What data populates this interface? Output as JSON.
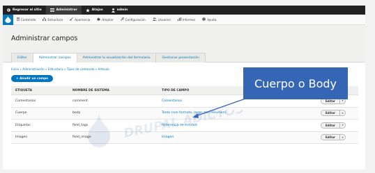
{
  "toolbar": {
    "items": [
      {
        "label": "Regresar al sitio",
        "icon": "arrow-left-icon"
      },
      {
        "label": "Administrar",
        "icon": "menu-icon"
      },
      {
        "label": "Atajos",
        "icon": "star-icon"
      },
      {
        "label": "admin",
        "icon": "user-icon"
      }
    ]
  },
  "subbar": {
    "items": [
      {
        "label": "Contenido",
        "icon": "document-icon"
      },
      {
        "label": "Estructura",
        "icon": "structure-icon"
      },
      {
        "label": "Apariencia",
        "icon": "brush-icon"
      },
      {
        "label": "Ampliar",
        "icon": "puzzle-icon"
      },
      {
        "label": "Configuración",
        "icon": "wrench-icon"
      },
      {
        "label": "Usuarios",
        "icon": "users-icon"
      },
      {
        "label": "Informes",
        "icon": "chart-icon"
      },
      {
        "label": "Ayuda",
        "icon": "help-icon"
      }
    ]
  },
  "header": {
    "title": "Administrar campos",
    "tabs": [
      "Editar",
      "Administrar campos",
      "Administrar la visualización del formulario",
      "Gestionar presentación"
    ]
  },
  "breadcrumb": "Inicio » Administración » Estructura » Tipos de contenido » Artículo",
  "add_field_button": "+ Añadir un campo",
  "table": {
    "headers": [
      "ETIQUETA",
      "NOMBRE DE SISTEMA",
      "TIPO DE CAMPO",
      ""
    ],
    "rows": [
      {
        "label": "Comentarios",
        "machine": "comment",
        "type": "Comentarios",
        "op": "Editar"
      },
      {
        "label": "Cuerpo",
        "machine": "body",
        "type": "Texto (con formato, largo, con resumen)",
        "op": "Editar"
      },
      {
        "label": "Etiquetas",
        "machine": "field_tags",
        "type": "Referencia de entidad",
        "op": "Editar"
      },
      {
        "label": "Imagen",
        "machine": "field_image",
        "type": "Imagen",
        "op": "Editar"
      }
    ]
  },
  "callout": "Cuerpo o Body",
  "watermark": "DRUPAL ADICTOS",
  "colors": {
    "accent": "#0074bd",
    "callout": "#3566b5",
    "toolbar": "#222222"
  }
}
